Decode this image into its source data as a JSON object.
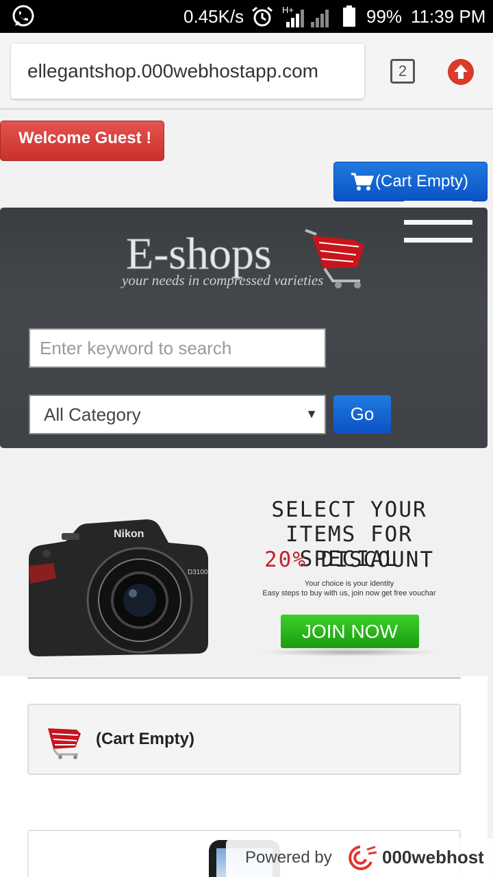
{
  "status_bar": {
    "speed": "0.45K/s",
    "signal_label": "H+",
    "battery": "99%",
    "time": "11:39 PM"
  },
  "browser": {
    "url": "ellegantshop.000webhostapp.com",
    "tab_count": "2"
  },
  "header": {
    "welcome": "Welcome Guest !",
    "cart_button": "(Cart Empty)",
    "logo_main": "E-shops",
    "logo_tagline": "your needs in compressed varieties",
    "search_placeholder": "Enter keyword to search",
    "category_selected": "All Category",
    "go_label": "Go"
  },
  "banner": {
    "line1": "SELECT YOUR",
    "line2": "ITEMS FOR SPECIAL",
    "line3_percent": "20%",
    "line3_rest": "DISCOUNT",
    "sub1": "Your choice is your identity",
    "sub2": "Easy steps to buy with us, join now get free vouchar",
    "join": "JOIN NOW",
    "camera_brand": "Nikon",
    "camera_model": "D3100"
  },
  "cart_panel": {
    "label": "(Cart Empty)"
  },
  "footer_badge": {
    "powered": "Powered by",
    "brand": "000webhost"
  },
  "colors": {
    "red": "#c9302c",
    "blue": "#0b52c4",
    "green": "#1a9c10",
    "dark": "#3f4246"
  }
}
